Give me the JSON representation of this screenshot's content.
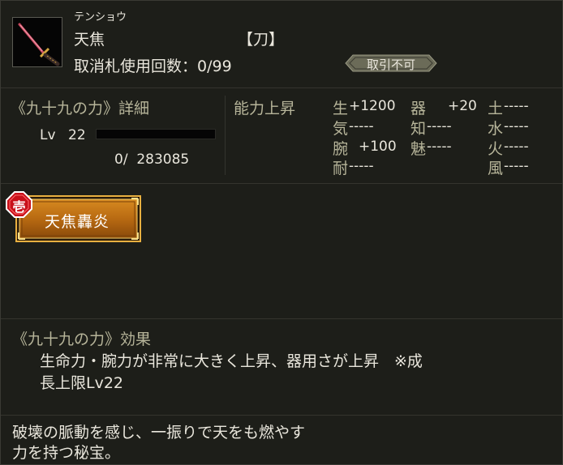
{
  "item": {
    "furigana": "テンショウ",
    "name": "天焦",
    "type": "【刀】",
    "cancel_label": "取消札使用回数：0/99",
    "trade_badge": "取引不可",
    "icon_name": "katana-icon"
  },
  "detail": {
    "title": "《九十九の力》詳細",
    "lv_label": "Lv",
    "lv_value": "22",
    "xp": "0/  283085",
    "progress": 0
  },
  "stats": {
    "title": "能力上昇",
    "items": [
      {
        "key": "生",
        "value": "+1200"
      },
      {
        "key": "気",
        "value": "-----"
      },
      {
        "key": "腕",
        "value": "+100"
      },
      {
        "key": "耐",
        "value": "-----"
      },
      {
        "key": "器",
        "value": "+20"
      },
      {
        "key": "知",
        "value": "-----"
      },
      {
        "key": "魅",
        "value": "-----"
      },
      {
        "key": "土",
        "value": "-----"
      },
      {
        "key": "水",
        "value": "-----"
      },
      {
        "key": "火",
        "value": "-----"
      },
      {
        "key": "風",
        "value": "-----"
      }
    ]
  },
  "skill": {
    "rank": "壱",
    "label": "天焦轟炎"
  },
  "effect": {
    "title": "《九十九の力》効果",
    "line1": "生命力・腕力が非常に大きく上昇、器用さが上昇　※成",
    "line2": "長上限Lv22"
  },
  "description": {
    "line1": "破壊の脈動を感じ、一振りで天をも燃やす",
    "line2": "力を持つ秘宝。"
  },
  "colors": {
    "background": "#1d1e19",
    "label_gold": "#b7b59a",
    "button_orange": "#b86a12",
    "badge_red": "#c8101a"
  }
}
